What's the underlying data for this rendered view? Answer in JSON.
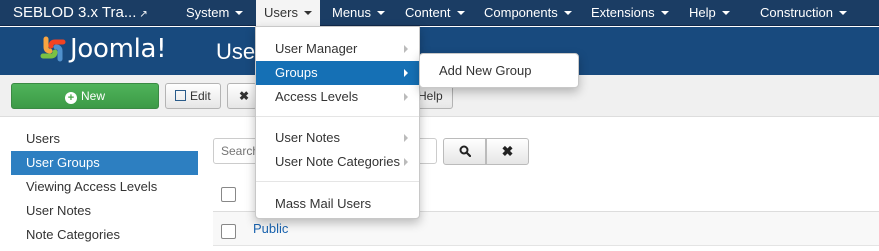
{
  "navbar": {
    "brand": "SEBLOD 3.x Tra...",
    "items": [
      {
        "label": "System"
      },
      {
        "label": "Users"
      },
      {
        "label": "Menus"
      },
      {
        "label": "Content"
      },
      {
        "label": "Components"
      },
      {
        "label": "Extensions"
      },
      {
        "label": "Help"
      },
      {
        "label": "Construction"
      }
    ]
  },
  "header": {
    "logo_text": "Joomla!",
    "title": "Users: Groups"
  },
  "toolbar": {
    "new_label": "New",
    "edit_label": "Edit",
    "close_glyph": "✖",
    "help_label": "Help"
  },
  "sidebar": {
    "items": [
      {
        "label": "Users"
      },
      {
        "label": "User Groups"
      },
      {
        "label": "Viewing Access Levels"
      },
      {
        "label": "User Notes"
      },
      {
        "label": "Note Categories"
      }
    ]
  },
  "filter": {
    "search_placeholder": "Search"
  },
  "table": {
    "rows": [
      {
        "title": "Public"
      }
    ]
  },
  "users_menu": {
    "items": [
      {
        "label": "User Manager"
      },
      {
        "label": "Groups"
      },
      {
        "label": "Access Levels"
      },
      {
        "label": "User Notes"
      },
      {
        "label": "User Note Categories"
      },
      {
        "label": "Mass Mail Users"
      }
    ],
    "groups_submenu": [
      {
        "label": "Add New Group"
      }
    ]
  },
  "colors": {
    "navbar": "#1b3d64",
    "header": "#184a7e",
    "accent": "#1570b5",
    "new_button": "#46a546"
  },
  "icons": {
    "external": "external-link-icon",
    "plus": "plus-circle-icon",
    "edit": "edit-icon",
    "search": "search-icon",
    "clear": "close-icon"
  }
}
